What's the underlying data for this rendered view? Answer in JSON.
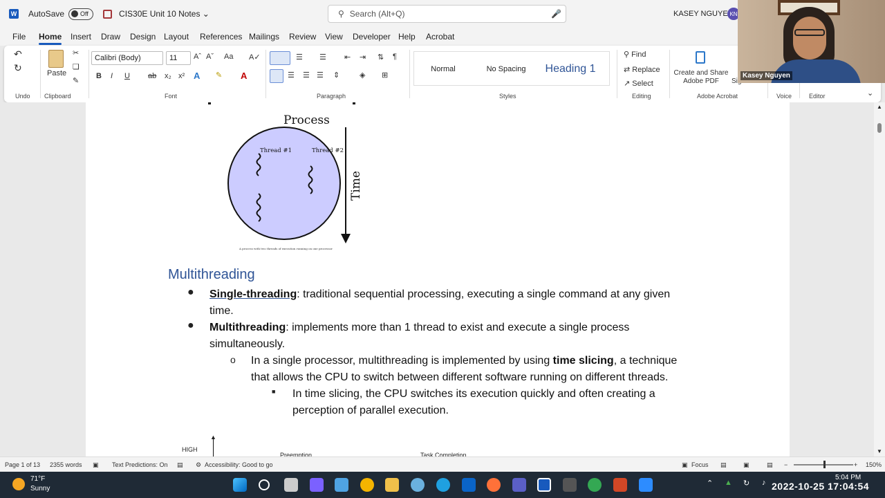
{
  "titlebar": {
    "autosave_label": "AutoSave",
    "autosave_state": "Off",
    "doc_title": "CIS30E Unit 10 Notes",
    "search_placeholder": "Search (Alt+Q)",
    "user_name": "KASEY NGUYEN",
    "user_initials": "KN"
  },
  "menu": {
    "tabs": [
      "File",
      "Home",
      "Insert",
      "Draw",
      "Design",
      "Layout",
      "References",
      "Mailings",
      "Review",
      "View",
      "Developer",
      "Help",
      "Acrobat"
    ],
    "active": "Home"
  },
  "ribbon": {
    "undo_label": "Undo",
    "clipboard_label": "Clipboard",
    "paste_label": "Paste",
    "font_label": "Font",
    "font_name": "Calibri (Body)",
    "font_size": "11",
    "paragraph_label": "Paragraph",
    "styles_label": "Styles",
    "styles": [
      "Normal",
      "No Spacing",
      "Heading 1"
    ],
    "editing_label": "Editing",
    "find_label": "Find",
    "replace_label": "Replace",
    "select_label": "Select",
    "acrobat_label": "Adobe Acrobat",
    "acrobat_button": "Create and Share Adobe PDF",
    "signatures_label": "Signatures",
    "voice_label": "Voice",
    "editor_label": "Editor"
  },
  "document": {
    "diagram": {
      "title": "Process",
      "thread1": "Thread #1",
      "thread2": "Thread #2",
      "time_label": "Time",
      "caption": "A process with two threads of execution running on one processor",
      "fill_color": "#ccccff"
    },
    "heading": "Multithreading",
    "bullet1_bold": "Single-threading",
    "bullet1_text": ": traditional sequential processing, executing a single command at any given",
    "bullet1_cont": "time.",
    "bullet2_bold": "Multithreading",
    "bullet2_text": ": implements more than 1 thread to exist and execute a single process",
    "bullet2_cont": "simultaneously.",
    "sub1_pre": "In a single processor, multithreading is implemented by using ",
    "sub1_bold": "time slicing",
    "sub1_post": ", a technique",
    "sub1_cont": "that allows the CPU to switch between different software running on different threads.",
    "sub2_line1": "In time slicing, the CPU switches its execution quickly and often creating a",
    "sub2_line2": "perception of parallel execution.",
    "lower_high": "HIGH",
    "lower_preemption": "Preemption",
    "lower_task": "Task Completion"
  },
  "statusbar": {
    "page": "Page 1 of 13",
    "words": "2355 words",
    "predictions": "Text Predictions: On",
    "accessibility": "Accessibility: Good to go",
    "focus": "Focus",
    "zoom": "150%"
  },
  "taskbar": {
    "temp": "71°F",
    "weather": "Sunny",
    "time": "5:04 PM",
    "timestamp_overlay": "2022-10-25 17:04:54"
  },
  "webcam": {
    "name": "Kasey Nguyen"
  }
}
